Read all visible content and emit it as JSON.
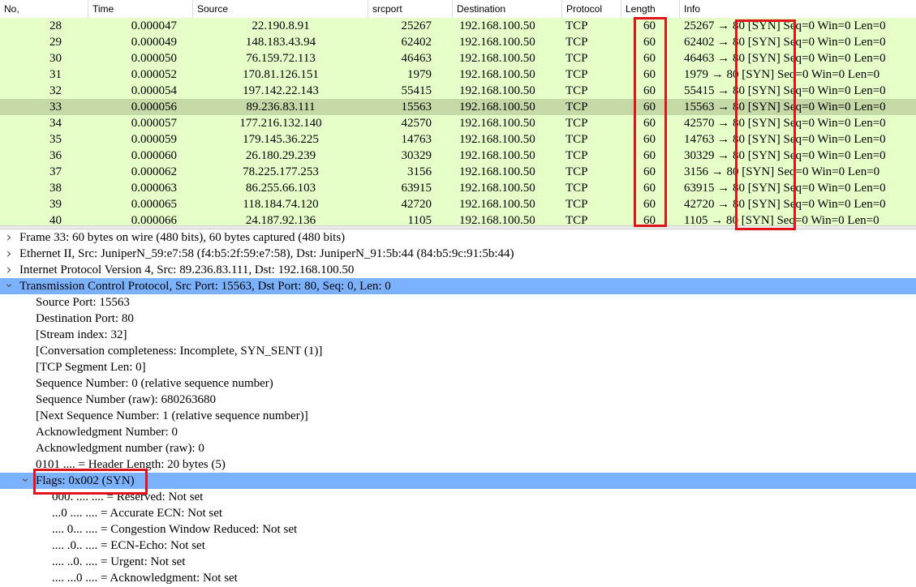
{
  "packet_list": {
    "columns": [
      "No,",
      "Time",
      "Source",
      "srcport",
      "Destination",
      "Protocol",
      "Length",
      "Info"
    ],
    "rows": [
      {
        "no": "28",
        "time": "0.000047",
        "source": "22.190.8.91",
        "srcport": "25267",
        "destination": "192.168.100.50",
        "protocol": "TCP",
        "length": "60",
        "info": "25267 → 80 [SYN] Seq=0 Win=0 Len=0"
      },
      {
        "no": "29",
        "time": "0.000049",
        "source": "148.183.43.94",
        "srcport": "62402",
        "destination": "192.168.100.50",
        "protocol": "TCP",
        "length": "60",
        "info": "62402 → 80 [SYN] Seq=0 Win=0 Len=0"
      },
      {
        "no": "30",
        "time": "0.000050",
        "source": "76.159.72.113",
        "srcport": "46463",
        "destination": "192.168.100.50",
        "protocol": "TCP",
        "length": "60",
        "info": "46463 → 80 [SYN] Seq=0 Win=0 Len=0"
      },
      {
        "no": "31",
        "time": "0.000052",
        "source": "170.81.126.151",
        "srcport": "1979",
        "destination": "192.168.100.50",
        "protocol": "TCP",
        "length": "60",
        "info": "1979 → 80 [SYN] Seq=0 Win=0 Len=0"
      },
      {
        "no": "32",
        "time": "0.000054",
        "source": "197.142.22.143",
        "srcport": "55415",
        "destination": "192.168.100.50",
        "protocol": "TCP",
        "length": "60",
        "info": "55415 → 80 [SYN] Seq=0 Win=0 Len=0"
      },
      {
        "no": "33",
        "time": "0.000056",
        "source": "89.236.83.111",
        "srcport": "15563",
        "destination": "192.168.100.50",
        "protocol": "TCP",
        "length": "60",
        "info": "15563 → 80 [SYN] Seq=0 Win=0 Len=0",
        "selected": true
      },
      {
        "no": "34",
        "time": "0.000057",
        "source": "177.216.132.140",
        "srcport": "42570",
        "destination": "192.168.100.50",
        "protocol": "TCP",
        "length": "60",
        "info": "42570 → 80 [SYN] Seq=0 Win=0 Len=0"
      },
      {
        "no": "35",
        "time": "0.000059",
        "source": "179.145.36.225",
        "srcport": "14763",
        "destination": "192.168.100.50",
        "protocol": "TCP",
        "length": "60",
        "info": "14763 → 80 [SYN] Seq=0 Win=0 Len=0"
      },
      {
        "no": "36",
        "time": "0.000060",
        "source": "26.180.29.239",
        "srcport": "30329",
        "destination": "192.168.100.50",
        "protocol": "TCP",
        "length": "60",
        "info": "30329 → 80 [SYN] Seq=0 Win=0 Len=0"
      },
      {
        "no": "37",
        "time": "0.000062",
        "source": "78.225.177.253",
        "srcport": "3156",
        "destination": "192.168.100.50",
        "protocol": "TCP",
        "length": "60",
        "info": "3156 → 80 [SYN] Seq=0 Win=0 Len=0"
      },
      {
        "no": "38",
        "time": "0.000063",
        "source": "86.255.66.103",
        "srcport": "63915",
        "destination": "192.168.100.50",
        "protocol": "TCP",
        "length": "60",
        "info": "63915 → 80 [SYN] Seq=0 Win=0 Len=0"
      },
      {
        "no": "39",
        "time": "0.000065",
        "source": "118.184.74.120",
        "srcport": "42720",
        "destination": "192.168.100.50",
        "protocol": "TCP",
        "length": "60",
        "info": "42720 → 80 [SYN] Seq=0 Win=0 Len=0"
      },
      {
        "no": "40",
        "time": "0.000066",
        "source": "24.187.92.136",
        "srcport": "1105",
        "destination": "192.168.100.50",
        "protocol": "TCP",
        "length": "60",
        "info": "1105 → 80 [SYN] Seq=0 Win=0 Len=0"
      }
    ]
  },
  "details": [
    {
      "level": 0,
      "expander": "collapsed",
      "text": "Frame 33: 60 bytes on wire (480 bits), 60 bytes captured (480 bits)"
    },
    {
      "level": 0,
      "expander": "collapsed",
      "text": "Ethernet II, Src: JuniperN_59:e7:58 (f4:b5:2f:59:e7:58), Dst: JuniperN_91:5b:44 (84:b5:9c:91:5b:44)"
    },
    {
      "level": 0,
      "expander": "collapsed",
      "text": "Internet Protocol Version 4, Src: 89.236.83.111, Dst: 192.168.100.50"
    },
    {
      "level": 0,
      "expander": "expanded",
      "text": "Transmission Control Protocol, Src Port: 15563, Dst Port: 80, Seq: 0, Len: 0",
      "highlight": true
    },
    {
      "level": 1,
      "text": "Source Port: 15563"
    },
    {
      "level": 1,
      "text": "Destination Port: 80"
    },
    {
      "level": 1,
      "text": "[Stream index: 32]"
    },
    {
      "level": 1,
      "text": "[Conversation completeness: Incomplete, SYN_SENT (1)]"
    },
    {
      "level": 1,
      "text": "[TCP Segment Len: 0]"
    },
    {
      "level": 1,
      "text": "Sequence Number: 0    (relative sequence number)"
    },
    {
      "level": 1,
      "text": "Sequence Number (raw): 680263680"
    },
    {
      "level": 1,
      "text": "[Next Sequence Number: 1    (relative sequence number)]"
    },
    {
      "level": 1,
      "text": "Acknowledgment Number: 0"
    },
    {
      "level": 1,
      "text": "Acknowledgment number (raw): 0"
    },
    {
      "level": 1,
      "text": "0101 .... = Header Length: 20 bytes (5)"
    },
    {
      "level": 1,
      "expander": "expanded",
      "text": "Flags: 0x002 (SYN)",
      "highlight": true
    },
    {
      "level": 2,
      "text": "000. .... .... = Reserved: Not set"
    },
    {
      "level": 2,
      "text": "...0 .... .... = Accurate ECN: Not set"
    },
    {
      "level": 2,
      "text": ".... 0... .... = Congestion Window Reduced: Not set"
    },
    {
      "level": 2,
      "text": ".... .0.. .... = ECN-Echo: Not set"
    },
    {
      "level": 2,
      "text": ".... ..0. .... = Urgent: Not set"
    },
    {
      "level": 2,
      "text": ".... ...0 .... = Acknowledgment: Not set"
    }
  ],
  "icons": {
    "collapsed": "chevron-right-icon",
    "expanded": "chevron-down-icon"
  },
  "colors": {
    "list_bg": "#e6ffc9",
    "selected_row": "#c5d9a7",
    "tree_highlight": "#7ab2ff",
    "annotation_red": "#e0151b"
  }
}
